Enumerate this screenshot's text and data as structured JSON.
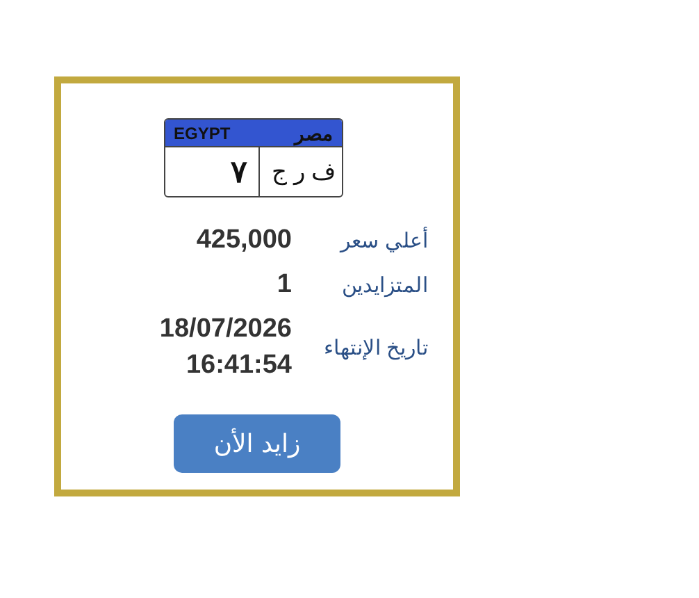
{
  "plate": {
    "country_en": "EGYPT",
    "country_ar": "مصر",
    "number": "٧",
    "letters": "ف ر ج"
  },
  "details": [
    {
      "label": "أعلي سعر",
      "value": "425,000"
    },
    {
      "label": "المتزايدين",
      "value": "1"
    },
    {
      "label": "تاريخ الإنتهاء",
      "value": "18/07/2026 16:41:54"
    }
  ],
  "button": {
    "label": "زايد الأن"
  }
}
